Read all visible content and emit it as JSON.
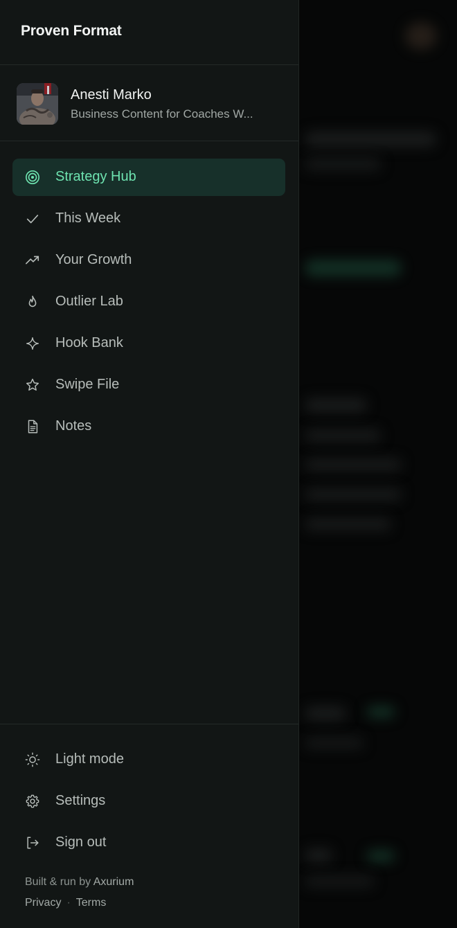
{
  "app": {
    "brand": "Proven Format"
  },
  "profile": {
    "name": "Anesti Marko",
    "subtitle": "Business Content for Coaches W..."
  },
  "nav": {
    "items": [
      {
        "label": "Strategy Hub",
        "icon": "target-icon",
        "active": true
      },
      {
        "label": "This Week",
        "icon": "check-icon",
        "active": false
      },
      {
        "label": "Your Growth",
        "icon": "trending-up-icon",
        "active": false
      },
      {
        "label": "Outlier Lab",
        "icon": "flame-icon",
        "active": false
      },
      {
        "label": "Hook Bank",
        "icon": "sparkle-icon",
        "active": false
      },
      {
        "label": "Swipe File",
        "icon": "star-icon",
        "active": false
      },
      {
        "label": "Notes",
        "icon": "document-icon",
        "active": false
      }
    ]
  },
  "footer": {
    "items": [
      {
        "label": "Light mode",
        "icon": "sun-icon"
      },
      {
        "label": "Settings",
        "icon": "gear-icon"
      },
      {
        "label": "Sign out",
        "icon": "sign-out-icon"
      }
    ],
    "built_prefix": "Built & run by",
    "built_by": "Axurium",
    "privacy": "Privacy",
    "separator": "·",
    "terms": "Terms"
  },
  "colors": {
    "accent": "#6ee3b0",
    "active_bg": "#17302a",
    "drawer_bg": "#121615"
  }
}
